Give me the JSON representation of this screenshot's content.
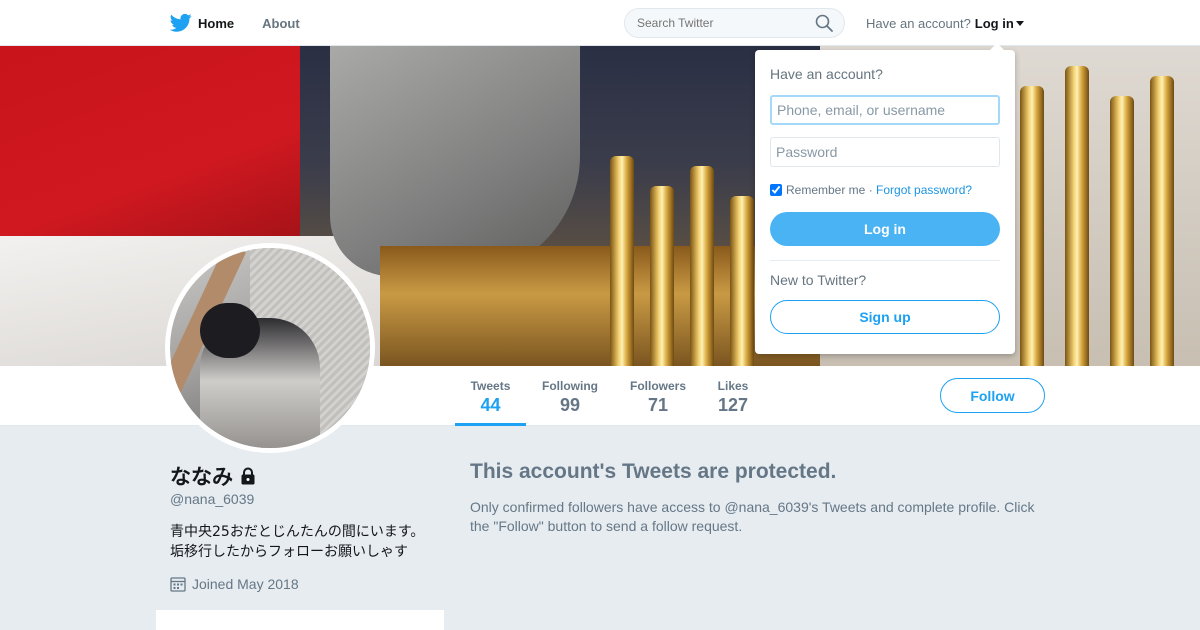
{
  "nav": {
    "home_label": "Home",
    "about_label": "About",
    "search_placeholder": "Search Twitter",
    "have_account": "Have an account?",
    "login_label": "Log in"
  },
  "profile": {
    "name": "ななみ",
    "screen_name": "@nana_6039",
    "bio_line1": "青中央25おだとじんたんの間にいます。",
    "bio_line2": "垢移行したからフォローお願いしゃす",
    "joined": "Joined May 2018",
    "follow_label": "Follow"
  },
  "stats": [
    {
      "label": "Tweets",
      "value": "44"
    },
    {
      "label": "Following",
      "value": "99"
    },
    {
      "label": "Followers",
      "value": "71"
    },
    {
      "label": "Likes",
      "value": "127"
    }
  ],
  "protected": {
    "title": "This account's Tweets are protected.",
    "text": "Only confirmed followers have access to @nana_6039's Tweets and complete profile. Click the \"Follow\" button to send a follow request."
  },
  "login_dropdown": {
    "heading": "Have an account?",
    "username_placeholder": "Phone, email, or username",
    "password_placeholder": "Password",
    "remember_label": "Remember me",
    "separator": " · ",
    "forgot_label": "Forgot password?",
    "login_button": "Log in",
    "new_to_twitter": "New to Twitter?",
    "signup_button": "Sign up"
  },
  "colors": {
    "accent": "#1da1f2",
    "background": "#e6ecf0",
    "muted_text": "#657786"
  },
  "icons": [
    "twitter-bird-icon",
    "search-icon",
    "caret-down-icon",
    "lock-icon",
    "calendar-icon"
  ]
}
